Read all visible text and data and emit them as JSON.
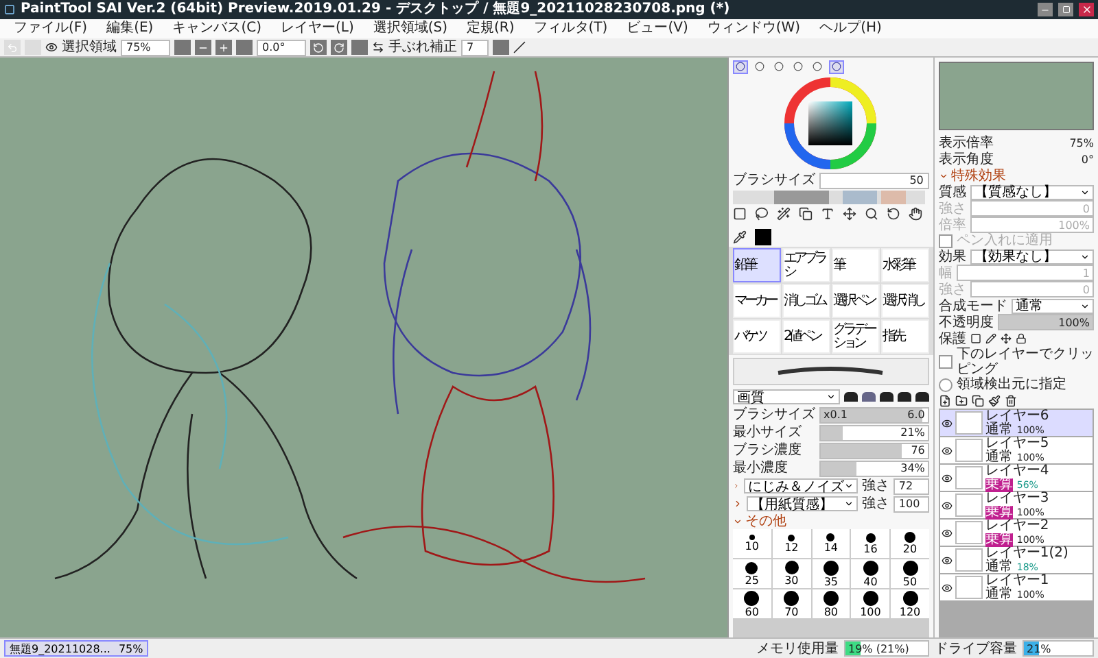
{
  "window": {
    "title": "PaintTool SAI Ver.2 (64bit) Preview.2019.01.29 - デスクトップ / 無題9_20211028230708.png (*)"
  },
  "menu": [
    "ファイル(F)",
    "編集(E)",
    "キャンバス(C)",
    "レイヤー(L)",
    "選択領域(S)",
    "定規(R)",
    "フィルタ(T)",
    "ビュー(V)",
    "ウィンドウ(W)",
    "ヘルプ(H)"
  ],
  "toolbar": {
    "selection_label": "選択領域",
    "selection_visible": true,
    "zoom": "75%",
    "angle": "0.0°",
    "stabilizer_label": "手ぶれ補正",
    "stabilizer": "7"
  },
  "color_tabs": [
    {
      "selected": true
    },
    {
      "selected": false
    },
    {
      "selected": false
    },
    {
      "selected": false
    },
    {
      "selected": false
    },
    {
      "selected": true
    }
  ],
  "brush_size_label": "ブラシサイズ",
  "brush_size": "50",
  "brush_tools": [
    {
      "label": "鉛筆",
      "selected": true
    },
    {
      "label": "エアブラシ",
      "selected": false
    },
    {
      "label": "筆",
      "selected": false
    },
    {
      "label": "水彩筆",
      "selected": false
    },
    {
      "label": "マーカー",
      "selected": false
    },
    {
      "label": "消しゴム",
      "selected": false
    },
    {
      "label": "選択ペン",
      "selected": false
    },
    {
      "label": "選択消し",
      "selected": false
    },
    {
      "label": "バケツ",
      "selected": false
    },
    {
      "label": "2値ペン",
      "selected": false
    },
    {
      "label": "グラデーション",
      "selected": false
    },
    {
      "label": "指先",
      "selected": false
    }
  ],
  "brush_shape": "画質",
  "brush_params": [
    {
      "label": "ブラシサイズ",
      "value": "6.0",
      "prefix": "x0.1",
      "level": 0.95
    },
    {
      "label": "最小サイズ",
      "value": "21%",
      "level": 0.21
    },
    {
      "label": "ブラシ濃度",
      "value": "76",
      "level": 0.76
    },
    {
      "label": "最小濃度",
      "value": "34%",
      "level": 0.34
    }
  ],
  "texture_rows": [
    {
      "name": "にじみ＆ノイズ",
      "strength_label": "強さ",
      "strength": "72"
    },
    {
      "name": "【用紙質感】",
      "strength_label": "強さ",
      "strength": "100"
    }
  ],
  "other_label": "その他",
  "brush_sizes": [
    "10",
    "12",
    "14",
    "16",
    "20",
    "25",
    "30",
    "35",
    "40",
    "50",
    "60",
    "70",
    "80",
    "100",
    "120"
  ],
  "navigator": {
    "zoom_label": "表示倍率",
    "zoom": "75%",
    "angle_label": "表示角度",
    "angle": "0°"
  },
  "effects": {
    "title": "特殊効果",
    "texture_label": "質感",
    "texture": "【質感なし】",
    "texture_rows": [
      {
        "label": "強さ",
        "value": "0"
      },
      {
        "label": "倍率",
        "value": "100%"
      }
    ],
    "apply_pen_label": "ペン入れに適用",
    "apply_pen": false,
    "effect_label": "効果",
    "effect": "【効果なし】",
    "effect_rows": [
      {
        "label": "幅",
        "value": "1"
      },
      {
        "label": "強さ",
        "value": "0"
      }
    ]
  },
  "layer_props": {
    "blend_label": "合成モード",
    "blend": "通常",
    "opacity_label": "不透明度",
    "opacity": {
      "value": "100%",
      "level": 1
    },
    "protect_label": "保護",
    "clip_label": "下のレイヤーでクリッピング",
    "clip": false,
    "detect_label": "領域検出元に指定",
    "detect": false
  },
  "layers": [
    {
      "name": "レイヤー6",
      "mode": "通常",
      "mode_tagged": false,
      "opacity": "100%",
      "reduced": false,
      "selected": true,
      "visible": true
    },
    {
      "name": "レイヤー5",
      "mode": "通常",
      "mode_tagged": false,
      "opacity": "100%",
      "reduced": false,
      "selected": false,
      "visible": true
    },
    {
      "name": "レイヤー4",
      "mode": "乗算",
      "mode_tagged": true,
      "opacity": "56%",
      "reduced": true,
      "selected": false,
      "visible": true
    },
    {
      "name": "レイヤー3",
      "mode": "乗算",
      "mode_tagged": true,
      "opacity": "100%",
      "reduced": false,
      "selected": false,
      "visible": true
    },
    {
      "name": "レイヤー2",
      "mode": "乗算",
      "mode_tagged": true,
      "opacity": "100%",
      "reduced": false,
      "selected": false,
      "visible": true
    },
    {
      "name": "レイヤー1(2)",
      "mode": "通常",
      "mode_tagged": false,
      "opacity": "18%",
      "reduced": true,
      "selected": false,
      "visible": true
    },
    {
      "name": "レイヤー1",
      "mode": "通常",
      "mode_tagged": false,
      "opacity": "100%",
      "reduced": false,
      "selected": false,
      "visible": true
    }
  ],
  "document_tab": {
    "name": "無題9_20211028...",
    "zoom": "75%",
    "selected": true
  },
  "status": {
    "memory_label": "メモリ使用量",
    "memory": {
      "value": "19%",
      "detail": "(21%)",
      "level": 0.19
    },
    "drive_label": "ドライブ容量",
    "drive": {
      "value": "21%",
      "level": 0.21
    }
  }
}
